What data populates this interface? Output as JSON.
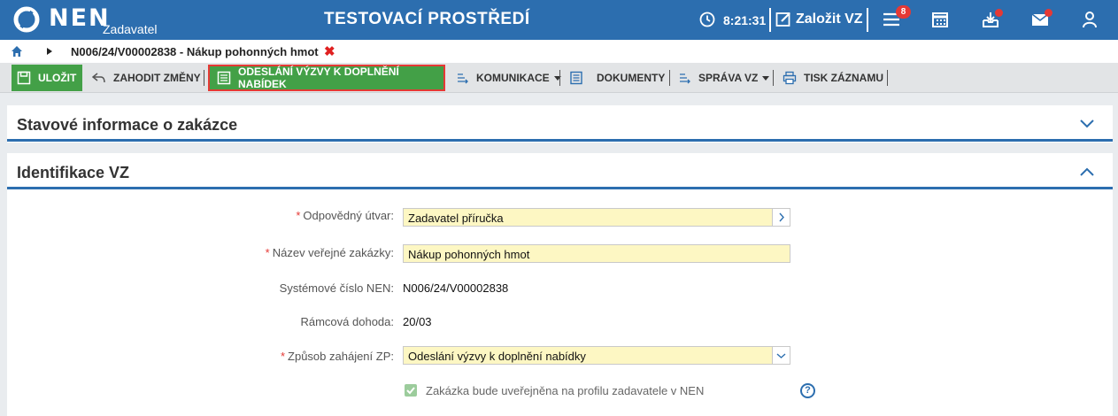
{
  "header": {
    "logo_text": "NEN",
    "logo_sub": "Zadavatel",
    "env_title": "TESTOVACÍ PROSTŘEDÍ",
    "clock": "8:21:31",
    "create_label": "Založit VZ",
    "menu_badge": "8",
    "colors": {
      "brand": "#2c6eaf",
      "badge": "#e53935"
    }
  },
  "breadcrumb": {
    "title": "N006/24/V00002838 - Nákup pohonných hmot",
    "close": "✖"
  },
  "toolbar": {
    "save": "ULOŽIT",
    "discard": "ZAHODIT ZMĚNY",
    "send": "ODESLÁNÍ VÝZVY K DOPLNĚNÍ NABÍDEK",
    "communication": "KOMUNIKACE",
    "documents": "DOKUMENTY",
    "manage": "SPRÁVA VZ",
    "print": "TISK ZÁZNAMU",
    "colors": {
      "action": "#43a047"
    }
  },
  "status_panel": {
    "title": "Stavové informace o zakázce"
  },
  "identification": {
    "title": "Identifikace VZ",
    "unit_label": "Odpovědný útvar:",
    "unit_value": "Zadavatel příručka",
    "name_label": "Název veřejné zakázky:",
    "name_value": "Nákup pohonných hmot",
    "sysnum_label": "Systémové číslo NEN:",
    "sysnum_value": "N006/24/V00002838",
    "framework_label": "Rámcová dohoda:",
    "framework_value": "20/03",
    "method_label": "Způsob zahájení ZP:",
    "method_value": "Odeslání výzvy k doplnění nabídky",
    "publish_label": "Zakázka bude uveřejněna na profilu zadavatele v NEN",
    "help": "?",
    "required_mark": "*"
  }
}
